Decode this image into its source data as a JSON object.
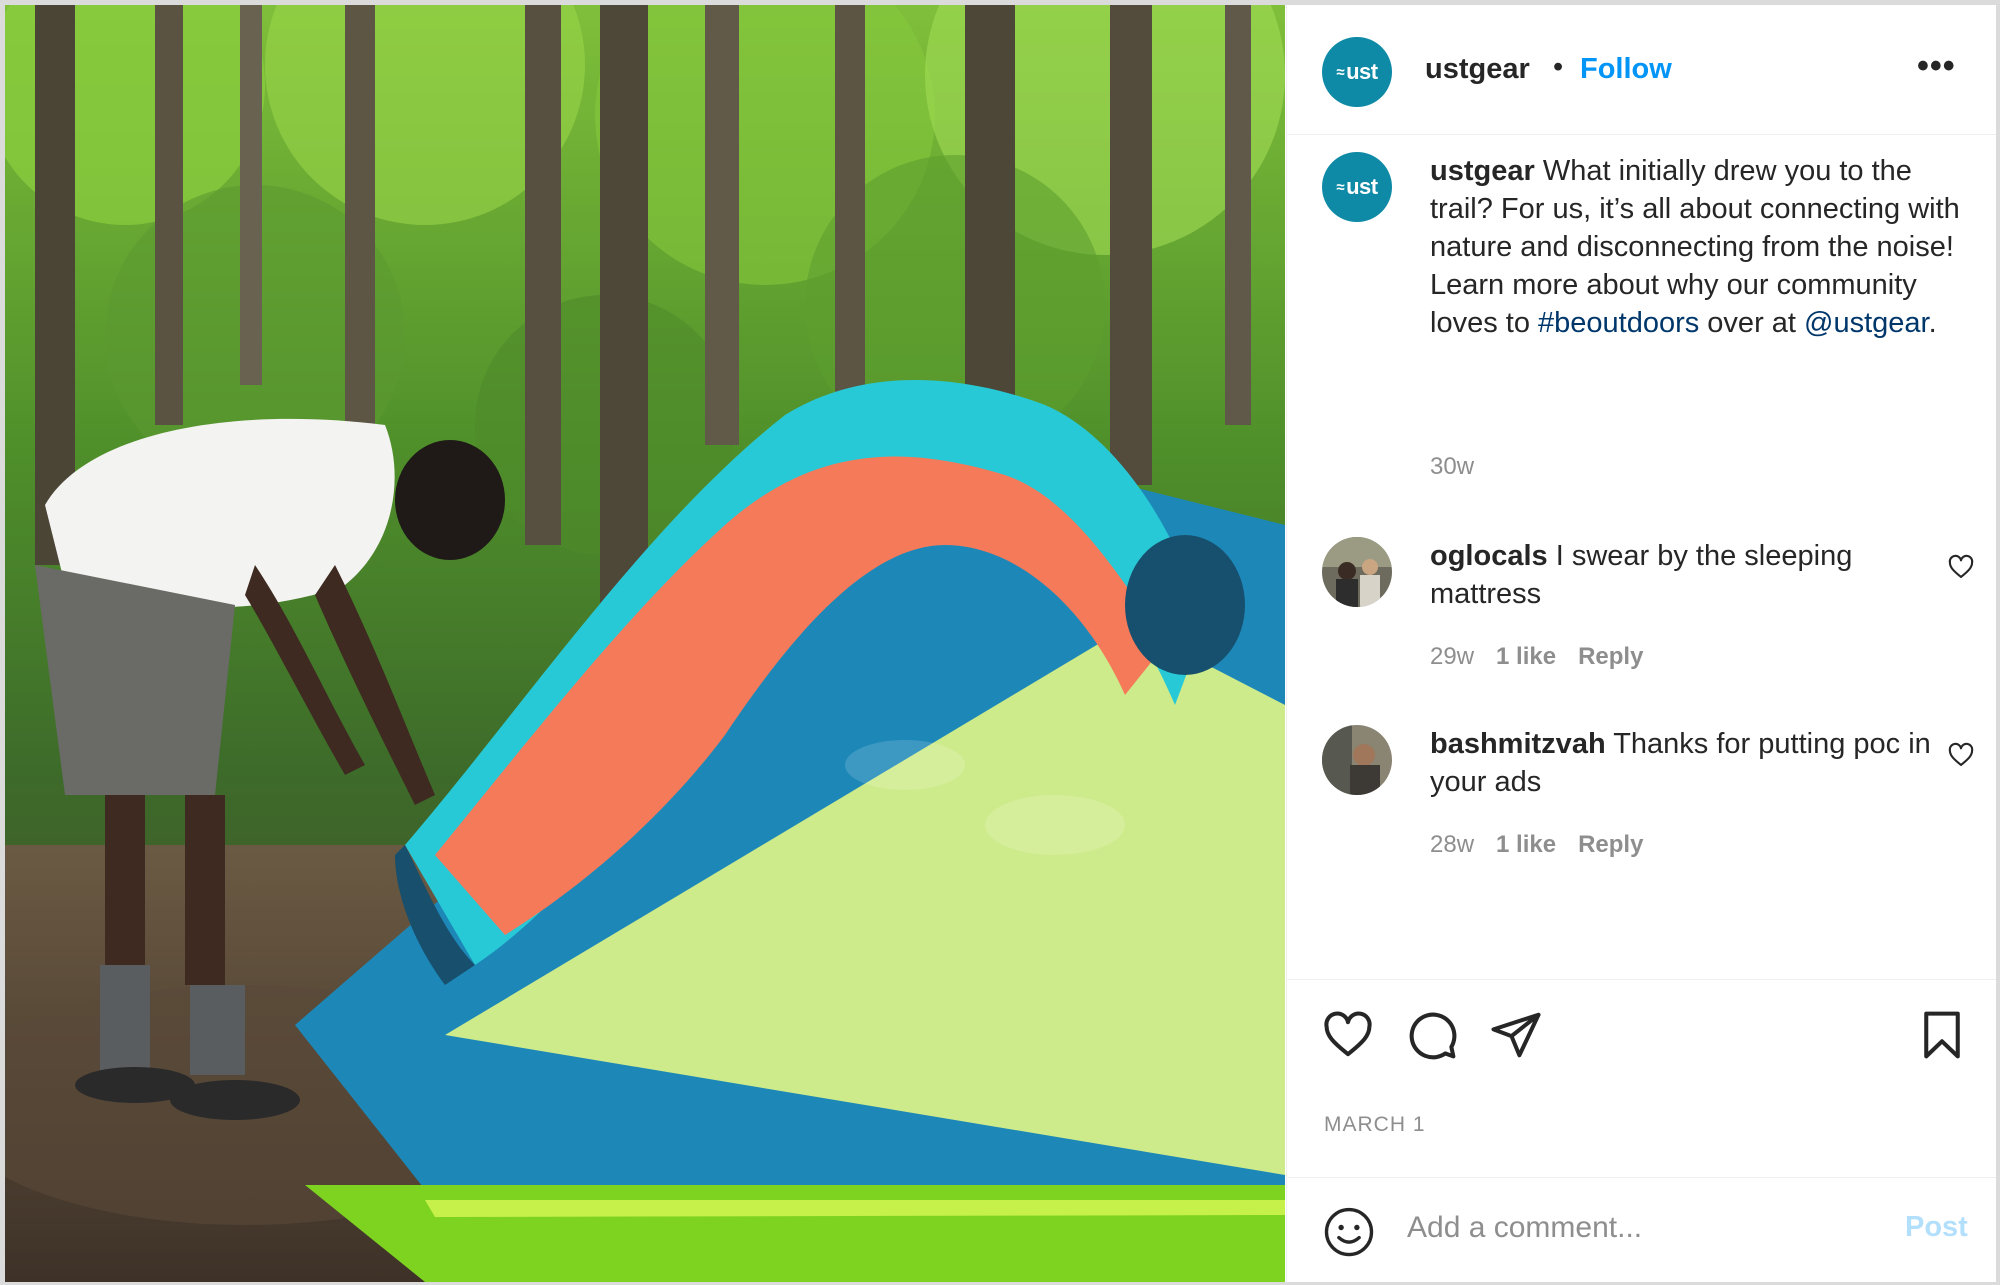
{
  "post": {
    "username": "ustgear",
    "separator": "•",
    "follow_label": "Follow",
    "more_label": "•••",
    "avatar_text": "ust"
  },
  "caption": {
    "username": "ustgear",
    "text_1": " What initially drew you to the trail? For us, it’s all about connecting with nature and disconnecting from the noise! Learn more about why our community loves to ",
    "hashtag": "#beoutdoors",
    "text_2": " over at ",
    "mention": "@ustgear",
    "text_3": ".",
    "time": "30w"
  },
  "comments": [
    {
      "username": "oglocals",
      "text": " I swear by the sleeping mattress",
      "time": "29w",
      "likes": "1 like",
      "reply": "Reply"
    },
    {
      "username": "bashmitzvah",
      "text": " Thanks for putting poc in your ads",
      "time": "28w",
      "likes": "1 like",
      "reply": "Reply"
    }
  ],
  "date": "MARCH 1",
  "add_comment": {
    "placeholder": "Add a comment...",
    "post_label": "Post"
  },
  "colors": {
    "accent": "#0095f6",
    "brand": "#0f8aa6",
    "link": "#00376b",
    "muted": "#8e8e8e"
  },
  "icons": [
    "heart-icon",
    "comment-icon",
    "share-icon",
    "bookmark-icon",
    "emoji-icon",
    "more-icon"
  ]
}
